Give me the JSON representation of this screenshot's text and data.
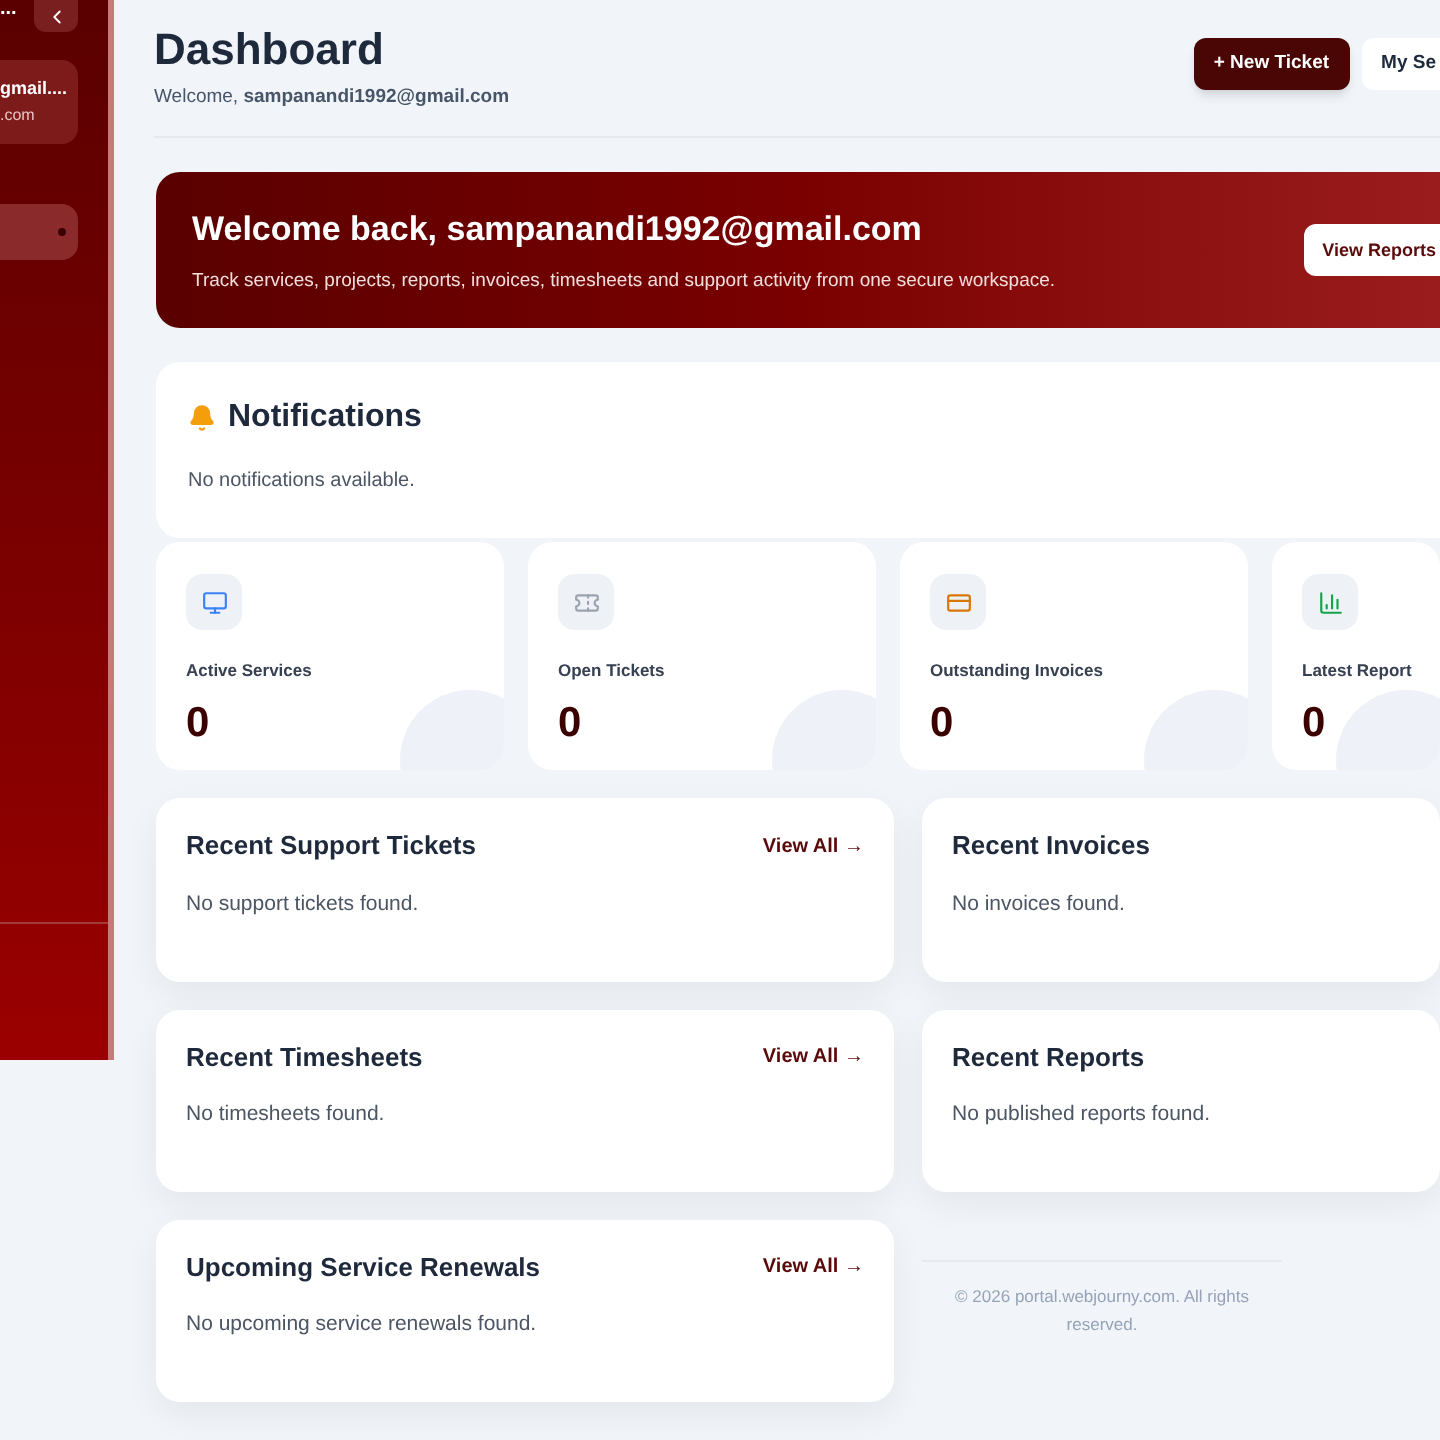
{
  "sidebar": {
    "top_text": "...",
    "user_name": "gmail....",
    "user_email": ".com"
  },
  "header": {
    "title": "Dashboard",
    "welcome_prefix": "Welcome, **sampanandi1992@gmail.com**",
    "buttons": [
      {
        "label": "+ New Ticket",
        "kind": "primary"
      },
      {
        "label": "My Se",
        "kind": "secondary"
      }
    ]
  },
  "hero": {
    "title": "Welcome back, sampanandi1992@gmail.com",
    "subtitle": "Track services, projects, reports, invoices, timesheets and support activity from one secure workspace.",
    "button": "View Reports"
  },
  "notifications": {
    "title": "Notifications",
    "message": "No notifications available."
  },
  "stats": [
    {
      "kind": "services",
      "label": "Active Services",
      "value": "0"
    },
    {
      "kind": "tickets",
      "label": "Open Tickets",
      "value": "0"
    },
    {
      "kind": "invoices",
      "label": "Outstanding Invoices",
      "value": "0"
    },
    {
      "kind": "reports",
      "label": "Latest Report",
      "value": "0"
    }
  ],
  "panels": [
    {
      "title": "Recent Support Tickets",
      "link": "View All →",
      "message": "No support tickets found."
    },
    {
      "title": "Recent Invoices",
      "message": "No invoices found."
    },
    {
      "title": "Recent Timesheets",
      "link": "View All →",
      "message": "No timesheets found."
    },
    {
      "title": "Recent Reports",
      "message": "No published reports found."
    },
    {
      "title": "Upcoming Service Renewals",
      "link": "View All →",
      "message": "No upcoming service renewals found."
    }
  ],
  "footer": "© 2026 portal.webjourny.com. All rights reserved."
}
